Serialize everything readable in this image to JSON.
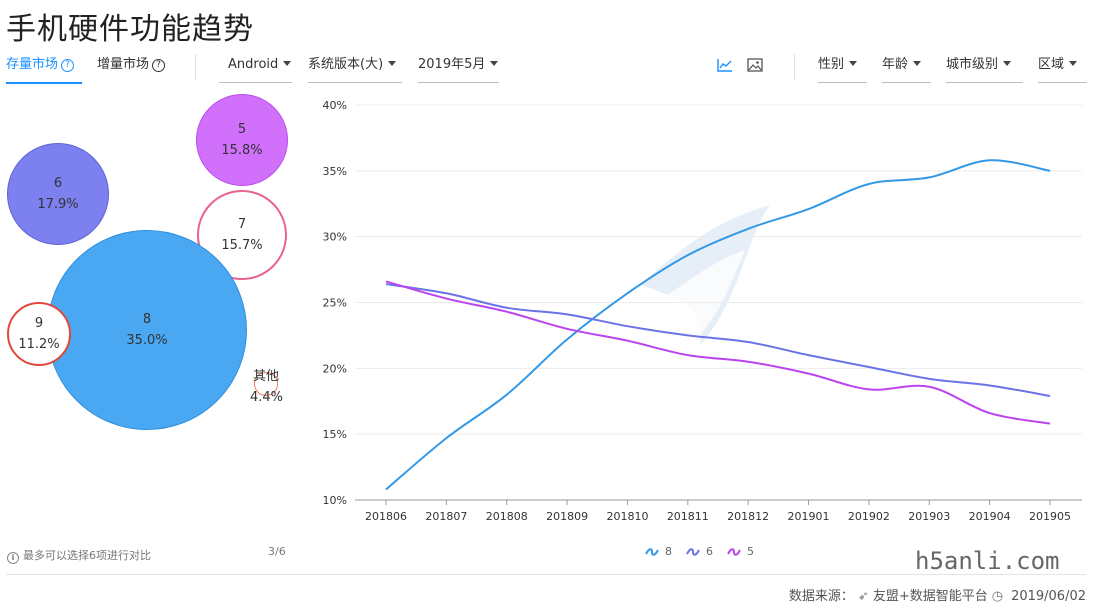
{
  "title": "手机硬件功能趋势",
  "market_tabs": {
    "stock": "存量市场",
    "incremental": "增量市场"
  },
  "filters": {
    "os": "Android",
    "version": "系统版本(大)",
    "month": "2019年5月"
  },
  "dimensions": {
    "gender": "性别",
    "age": "年龄",
    "city_level": "城市级别",
    "region": "区域"
  },
  "bubbles": [
    {
      "name": "5",
      "pct": "15.8%",
      "color": "#cc66ff"
    },
    {
      "name": "6",
      "pct": "17.9%",
      "color": "#7b7ef0"
    },
    {
      "name": "7",
      "pct": "15.7%",
      "color": "#e8638f"
    },
    {
      "name": "8",
      "pct": "35.0%",
      "color": "#4aa8f2"
    },
    {
      "name": "9",
      "pct": "11.2%",
      "color": "#e0473d"
    },
    {
      "name": "其他",
      "pct": "4.4%",
      "color": "#e8825a"
    }
  ],
  "hint": "最多可以选择6项进行对比",
  "page_count": "3/6",
  "chart_data": {
    "type": "line",
    "x": [
      "201806",
      "201807",
      "201808",
      "201809",
      "201810",
      "201811",
      "201812",
      "201901",
      "201902",
      "201903",
      "201904",
      "201905"
    ],
    "ylim": [
      10,
      40
    ],
    "yticks": [
      10,
      15,
      20,
      25,
      30,
      35,
      40
    ],
    "ytick_labels": [
      "10%",
      "15%",
      "20%",
      "25%",
      "30%",
      "35%",
      "40%"
    ],
    "grid": true,
    "legend_position": "bottom",
    "series": [
      {
        "name": "8",
        "color": "#3399e6",
        "values": [
          10.8,
          14.7,
          18.0,
          22.2,
          25.7,
          28.6,
          30.6,
          32.1,
          34.0,
          34.5,
          35.8,
          35.0
        ]
      },
      {
        "name": "6",
        "color": "#6b73e6",
        "values": [
          26.4,
          25.7,
          24.6,
          24.1,
          23.2,
          22.5,
          22.0,
          21.0,
          20.1,
          19.2,
          18.7,
          17.9
        ]
      },
      {
        "name": "5",
        "color": "#bb44ee",
        "values": [
          26.6,
          25.3,
          24.3,
          23.0,
          22.1,
          21.0,
          20.5,
          19.6,
          18.4,
          18.6,
          16.6,
          15.8
        ]
      }
    ]
  },
  "source": {
    "label": "数据来源：",
    "provider": "友盟+数据智能平台",
    "date": "2019/06/02"
  },
  "watermark": "h5anli.com"
}
